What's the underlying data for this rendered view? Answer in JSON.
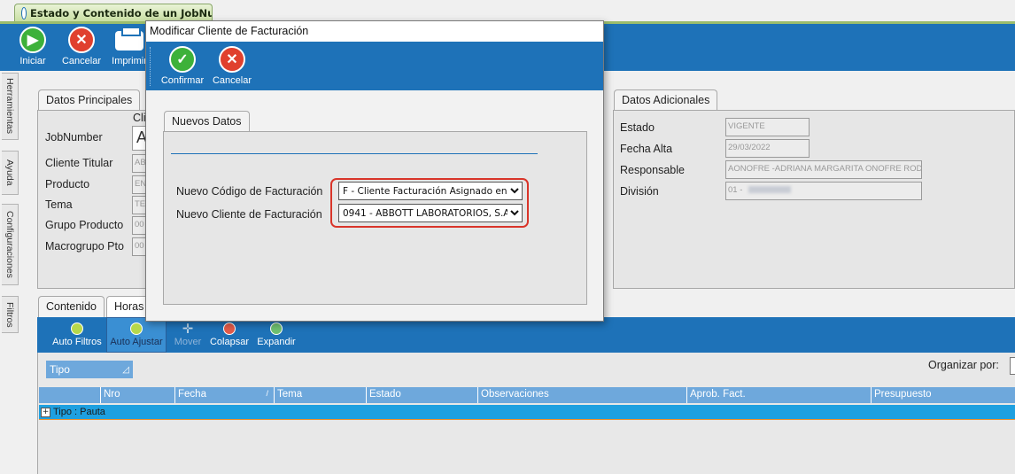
{
  "window": {
    "tab_title": "Estado y Contenido de un JobNu..."
  },
  "main_toolbar": {
    "start_label": "Iniciar",
    "cancel_label": "Cancelar",
    "print_label": "Imprimir"
  },
  "side_tabs": [
    "Herramientas",
    "Ayuda",
    "Configuraciones",
    "Filtros"
  ],
  "datos_principales": {
    "tab_label": "Datos Principales",
    "column_header_partial": "Cli",
    "labels": [
      "JobNumber",
      "Cliente Titular",
      "Producto",
      "Tema",
      "Grupo Producto",
      "Macrogrupo Pto"
    ],
    "values": [
      "A",
      "AB",
      "EN",
      "TE",
      "00",
      "00"
    ]
  },
  "datos_adicionales": {
    "tab_label": "Datos Adicionales",
    "labels": [
      "Estado",
      "Fecha Alta",
      "Responsable",
      "División"
    ],
    "values": [
      "VIGENTE",
      "29/03/2022",
      "AONOFRE -ADRIANA MARGARITA ONOFRE ROD",
      "01 -"
    ]
  },
  "bottom_tabs": [
    "Contenido",
    "Horas"
  ],
  "grid_toolbar": {
    "auto_filtros": "Auto Filtros",
    "auto_ajustar": "Auto Ajustar",
    "mover": "Mover",
    "colapsar": "Colapsar",
    "expandir": "Expandir"
  },
  "grid": {
    "group_chip": "Tipo",
    "organizar_label": "Organizar por:",
    "columns": [
      "Nro",
      "Fecha",
      "Tema",
      "Estado",
      "Observaciones",
      "Aprob. Fact.",
      "Presupuesto"
    ],
    "group_row_label": "Tipo : Pauta",
    "expand_glyph": "+"
  },
  "dialog": {
    "title": "Modificar Cliente de Facturación",
    "confirm_label": "Confirmar",
    "cancel_label": "Cancelar",
    "tab_label": "Nuevos Datos",
    "codigo_label": "Nuevo Código de Facturación",
    "cliente_label": "Nuevo Cliente de Facturación",
    "codigo_value": "F - Cliente Facturación Asignado en Jo",
    "cliente_value": "0941 - ABBOTT LABORATORIOS, S.A"
  },
  "colors": {
    "toolbar_blue": "#1e72b8",
    "highlight_red": "#d9352a",
    "grid_header": "#6ea8dc",
    "group_row": "#1ea0e0"
  }
}
